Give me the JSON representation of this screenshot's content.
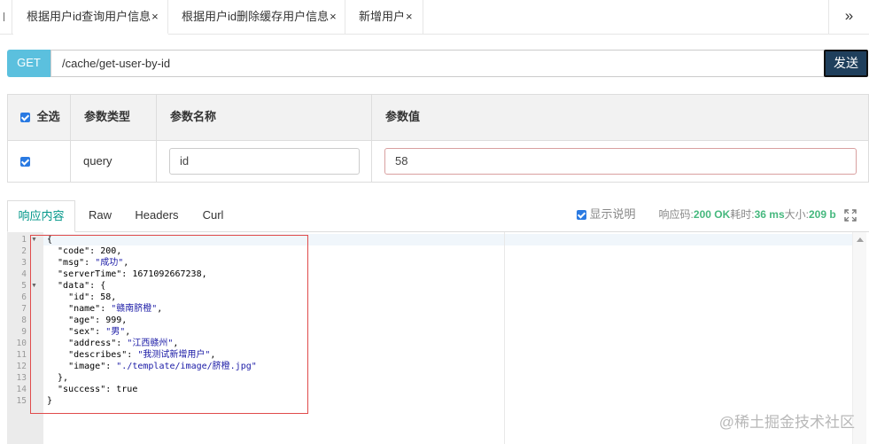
{
  "tabs": [
    {
      "label": "根据用户id查询用户信息",
      "close": "×",
      "active": true
    },
    {
      "label": "根据用户id删除缓存用户信息",
      "close": "×",
      "active": false
    },
    {
      "label": "新增用户",
      "close": "×",
      "active": false
    }
  ],
  "tab_more": "»",
  "request": {
    "method": "GET",
    "url": "/cache/get-user-by-id",
    "send_label": "发送"
  },
  "params": {
    "headers": {
      "select_all": "全选",
      "type": "参数类型",
      "name": "参数名称",
      "value": "参数值"
    },
    "rows": [
      {
        "checked": true,
        "type": "query",
        "name": "id",
        "value": "58"
      }
    ]
  },
  "response_tabs": [
    "响应内容",
    "Raw",
    "Headers",
    "Curl"
  ],
  "response_meta": {
    "show_desc_label": "显示说明",
    "code_label": "响应码:",
    "code_value": "200 OK",
    "time_label": "耗时:",
    "time_value": "36 ms",
    "size_label": "大小:",
    "size_value": "209 b"
  },
  "code_lines": [
    {
      "n": "1",
      "fold": true,
      "text": "{"
    },
    {
      "n": "2",
      "text": "  \"code\": 200,"
    },
    {
      "n": "3",
      "text": "  \"msg\": \"成功\","
    },
    {
      "n": "4",
      "text": "  \"serverTime\": 1671092667238,"
    },
    {
      "n": "5",
      "fold": true,
      "text": "  \"data\": {"
    },
    {
      "n": "6",
      "text": "    \"id\": 58,"
    },
    {
      "n": "7",
      "text": "    \"name\": \"赣南脐橙\","
    },
    {
      "n": "8",
      "text": "    \"age\": 999,"
    },
    {
      "n": "9",
      "text": "    \"sex\": \"男\","
    },
    {
      "n": "10",
      "text": "    \"address\": \"江西赣州\","
    },
    {
      "n": "11",
      "text": "    \"describes\": \"我测试新增用户\","
    },
    {
      "n": "12",
      "text": "    \"image\": \"./template/image/脐橙.jpg\""
    },
    {
      "n": "13",
      "text": "  },"
    },
    {
      "n": "14",
      "text": "  \"success\": true"
    },
    {
      "n": "15",
      "text": "}"
    }
  ],
  "watermark": "@稀土掘金技术社区",
  "colors": {
    "method_bg": "#5bc0de",
    "send_bg": "#1f3f5c",
    "active_tab": "#009688",
    "status_green": "#46b87e",
    "highlight_box": "#e04b4b"
  }
}
